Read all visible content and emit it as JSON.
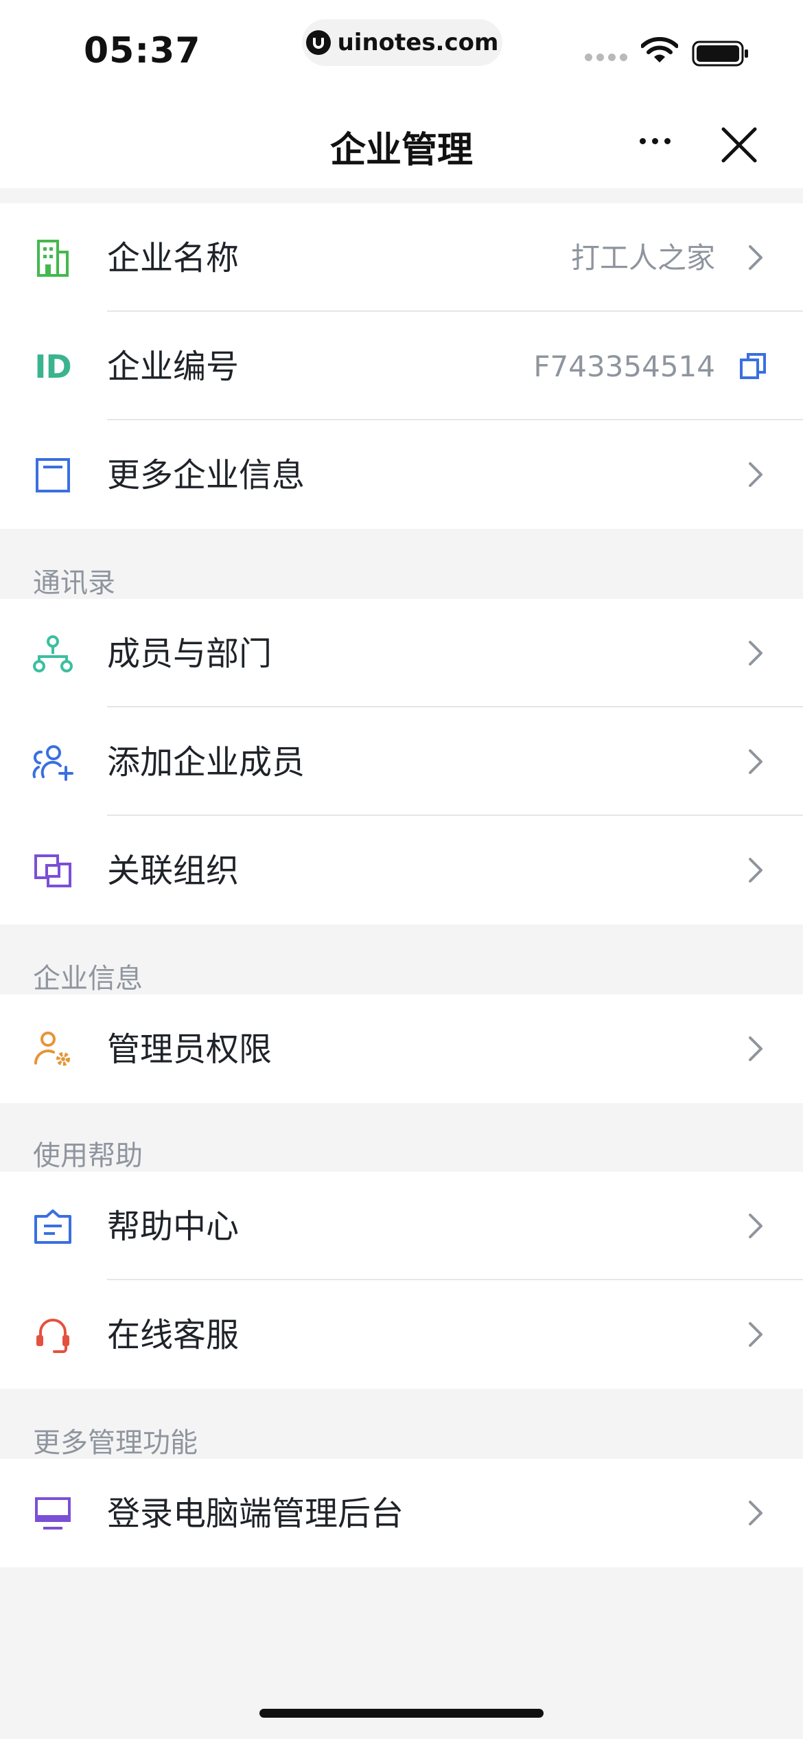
{
  "status_bar": {
    "time": "05:37",
    "url": "uinotes.com"
  },
  "nav": {
    "title": "企业管理"
  },
  "company": {
    "items": [
      {
        "label": "企业名称",
        "value": "打工人之家",
        "icon": "building-icon"
      },
      {
        "label": "企业编号",
        "value": "F743354514",
        "icon": "id-icon",
        "icon_text": "ID"
      },
      {
        "label": "更多企业信息",
        "icon": "info-card-icon"
      }
    ]
  },
  "contacts": {
    "title": "通讯录",
    "items": [
      {
        "label": "成员与部门",
        "icon": "org-structure-icon"
      },
      {
        "label": "添加企业成员",
        "icon": "add-member-icon"
      },
      {
        "label": "关联组织",
        "icon": "link-org-icon"
      }
    ]
  },
  "enterprise_info": {
    "title": "企业信息",
    "items": [
      {
        "label": "管理员权限",
        "icon": "admin-settings-icon"
      }
    ]
  },
  "help": {
    "title": "使用帮助",
    "items": [
      {
        "label": "帮助中心",
        "icon": "help-center-icon"
      },
      {
        "label": "在线客服",
        "icon": "headset-icon"
      }
    ]
  },
  "more_admin": {
    "title": "更多管理功能",
    "items": [
      {
        "label": "登录电脑端管理后台",
        "icon": "desktop-icon"
      }
    ]
  },
  "colors": {
    "green": "#43b94d",
    "teal": "#3bb38f",
    "blue": "#3a6fe0",
    "purple": "#7b4fd6",
    "orange": "#e69436",
    "red": "#e4523f",
    "gray_text": "#8f959e"
  }
}
